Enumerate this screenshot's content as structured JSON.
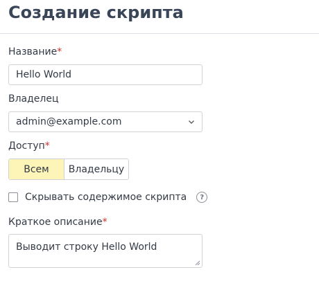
{
  "page": {
    "title": "Создание скрипта"
  },
  "form": {
    "name": {
      "label": "Название",
      "required_mark": "*",
      "value": "Hello World"
    },
    "owner": {
      "label": "Владелец",
      "value": "admin@example.com"
    },
    "access": {
      "label": "Доступ",
      "required_mark": "*",
      "options": [
        "Всем",
        "Владельцу"
      ],
      "selected": "Всем"
    },
    "hide_content": {
      "label": "Скрывать содержимое скрипта",
      "checked": false,
      "help_glyph": "?"
    },
    "description": {
      "label": "Краткое описание",
      "required_mark": "*",
      "value": "Выводит строку Hello World"
    }
  },
  "colors": {
    "accent_selected": "#fdf5b8",
    "required": "#c9302c",
    "title": "#3a4658"
  },
  "icons": {
    "owner_dropdown": "chevron-down-icon",
    "help": "help-circle-icon"
  }
}
